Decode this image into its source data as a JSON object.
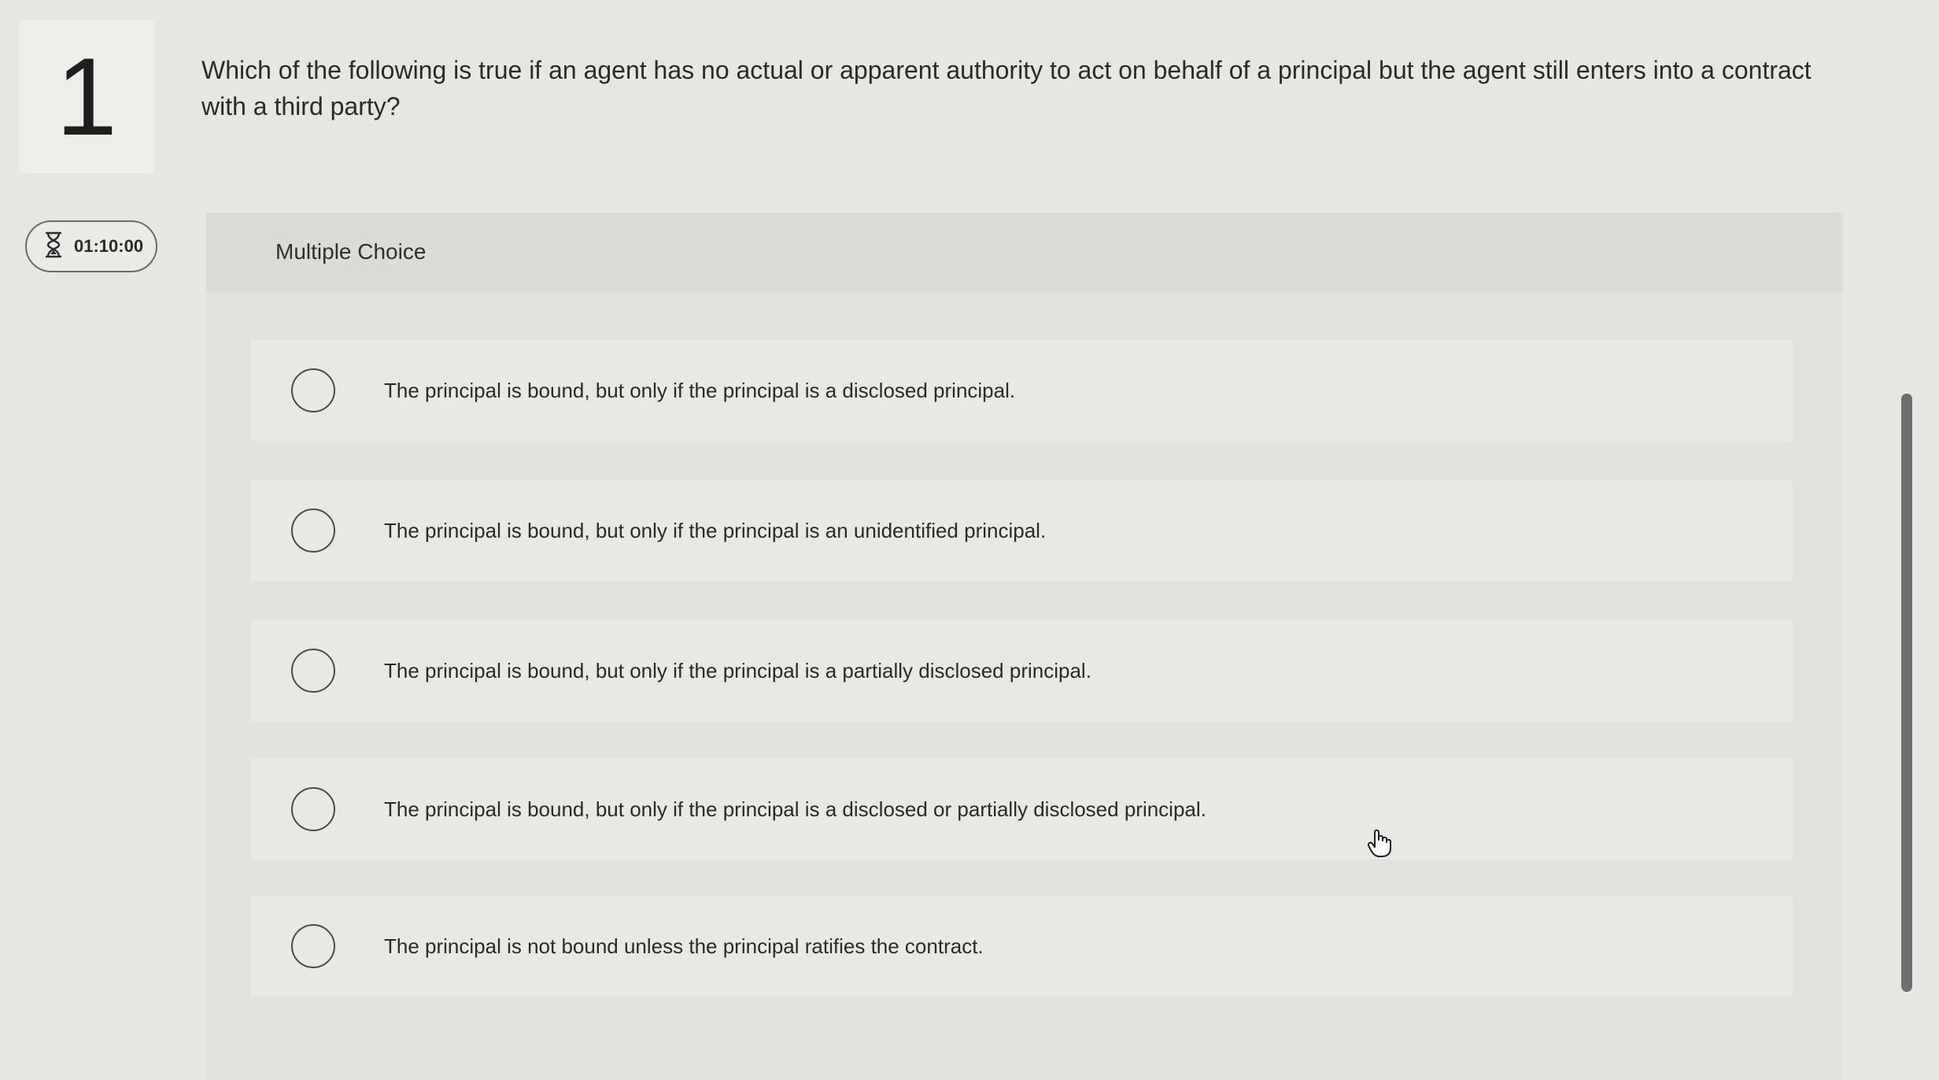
{
  "question": {
    "number": "1",
    "text": "Which of the following is true if an agent has no actual or apparent authority to act on behalf of a principal but the agent still enters into a contract with a third party?"
  },
  "timer": {
    "icon": "hourglass-icon",
    "value": "01:10:00"
  },
  "panel": {
    "header": "Multiple Choice",
    "options": [
      {
        "label": "The principal is bound, but only if the principal is a disclosed principal."
      },
      {
        "label": "The principal is bound, but only if the principal is an unidentified principal."
      },
      {
        "label": "The principal is bound, but only if the principal is a partially disclosed principal."
      },
      {
        "label": "The principal is bound, but only if the principal is a disclosed or partially disclosed principal."
      },
      {
        "label": "The principal is not bound unless the principal ratifies the contract."
      }
    ]
  },
  "colors": {
    "background": "#e7e6e3",
    "panel": "#e2e1de",
    "text": "#2a2a2a"
  }
}
